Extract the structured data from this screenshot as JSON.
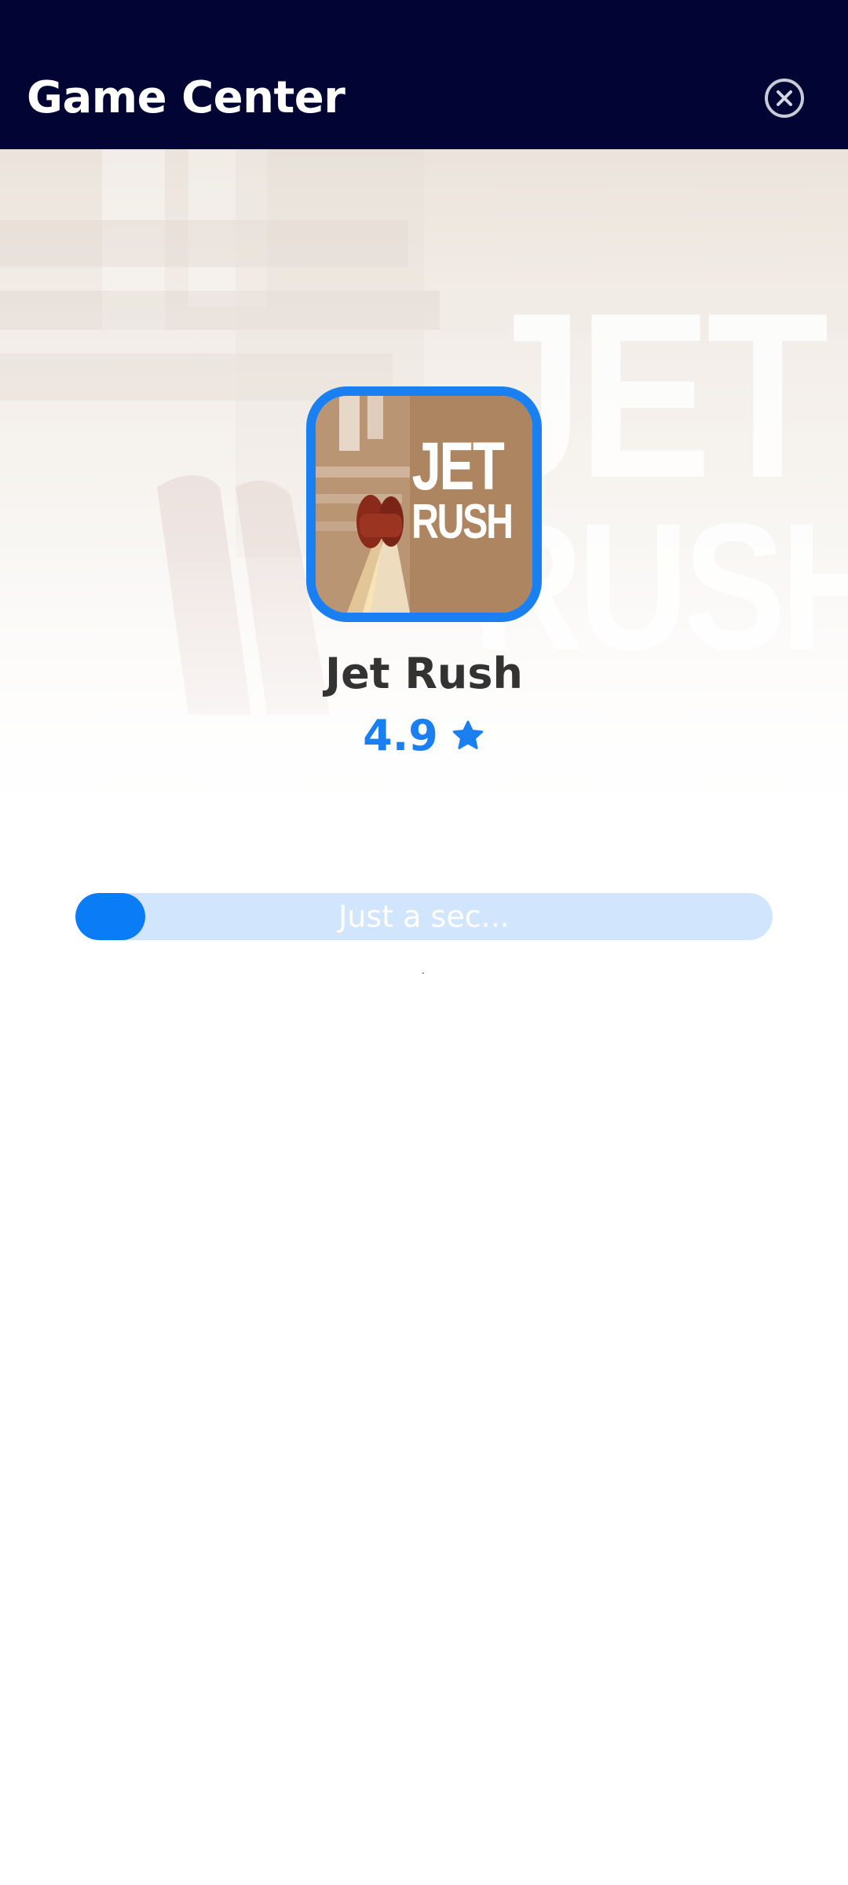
{
  "header": {
    "title": "Game Center",
    "close_icon": "close-circle-icon"
  },
  "game": {
    "icon_text_line1": "JET",
    "icon_text_line2": "RUSH",
    "title": "Jet Rush",
    "rating": "4.9",
    "rating_icon": "star-icon"
  },
  "loading": {
    "label": "Just a sec...",
    "progress_fraction": 0.1
  },
  "colors": {
    "header_bg": "#020434",
    "accent": "#1a7ff0",
    "progress_track": "#d1e5fd"
  }
}
